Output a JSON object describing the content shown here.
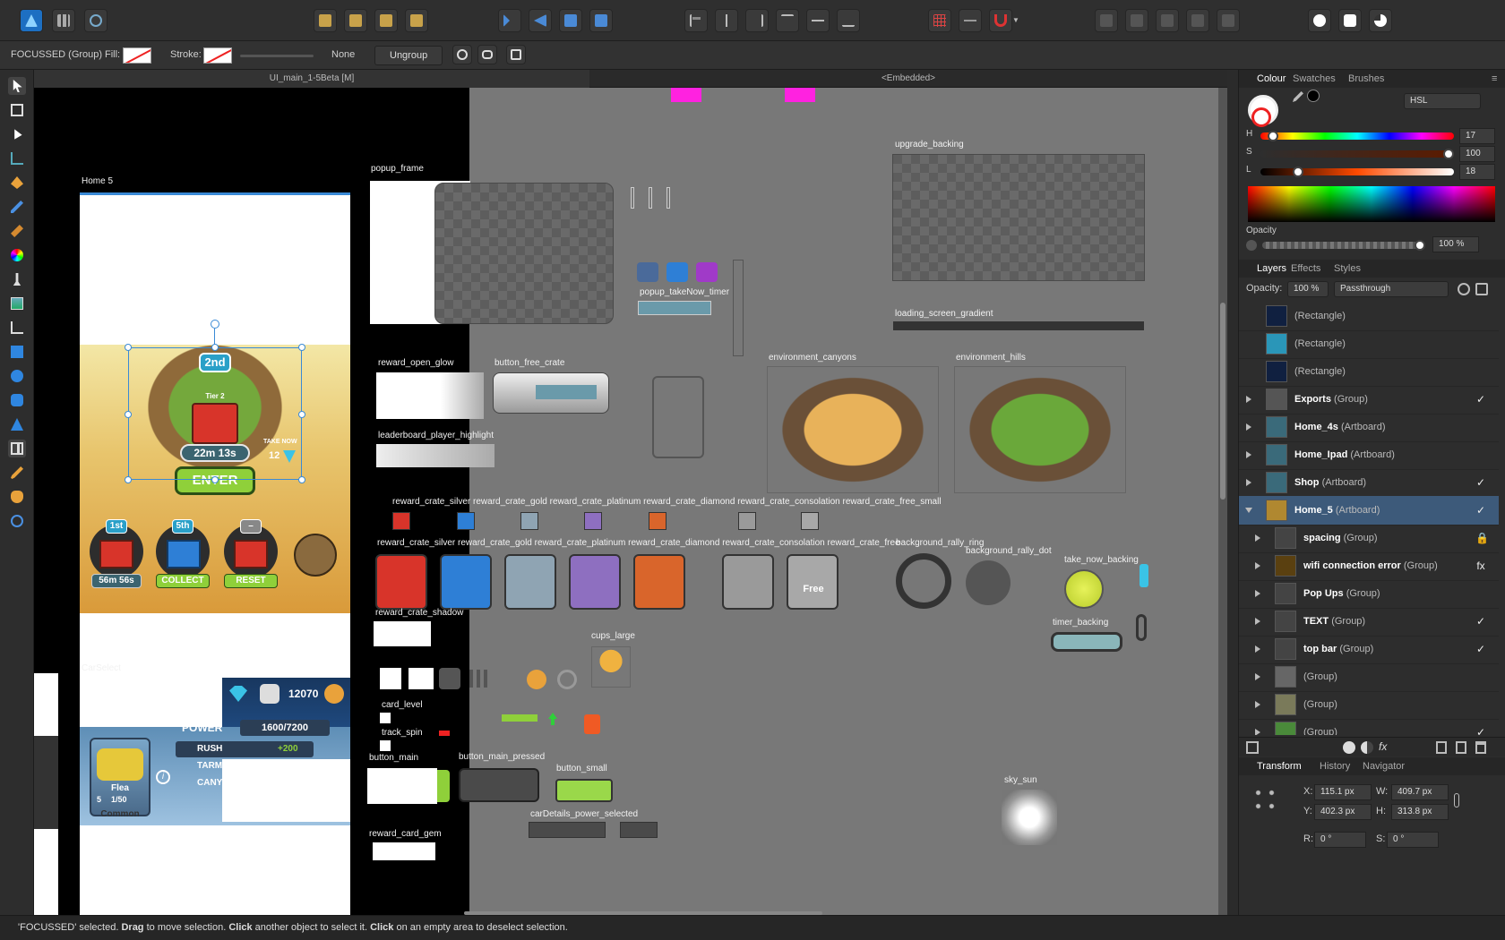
{
  "context_bar": {
    "selection": "FOCUSSED (Group)",
    "fill_label": "Fill:",
    "stroke_label": "Stroke:",
    "stroke_value": "None",
    "ungroup_label": "Ungroup"
  },
  "doc_tabs": [
    "UI_main_1-5Beta [M]",
    "<Embedded>"
  ],
  "canvas": {
    "labels": {
      "home5": "Home 5",
      "popup_frame": "popup_frame",
      "upgrade_backing": "upgrade_backing",
      "loading_gradient": "loading_screen_gradient",
      "reward_open_glow": "reward_open_glow",
      "button_free_crate": "button_free_crate",
      "leaderboard": "leaderboard_player_highlight",
      "popup_takenow": "popup_takeNow_timer",
      "env_canyons": "environment_canyons",
      "env_hills": "environment_hills",
      "reward_crate_small": "reward_crate_silver   reward_crate_gold   reward_crate_platinum   reward_crate_diamond   reward_crate_consolation   reward_crate_free_small",
      "reward_crate_big": "reward_crate_silver   reward_crate_gold   reward_crate_platinum   reward_crate_diamond   reward_crate_consolation   reward_crate_free",
      "bg_rally_ring": "background_rally_ring",
      "bg_rally_dot": "background_rally_dot",
      "take_now_backing": "take_now_backing",
      "timer_backing": "timer_backing",
      "reward_crate_shadow": "reward_crate_shadow",
      "cups_large": "cups_large",
      "card_level": "card_level",
      "track_spin": "track_spin",
      "button_main": "button_main",
      "button_main_pressed": "button_main_pressed",
      "button_small": "button_small",
      "sky_sun": "sky_sun",
      "carselect": "CarSelect",
      "reward_card_gem": "reward_card_gem",
      "cardetails": "carDetails_power_selected"
    },
    "home": {
      "tier_badge": "2nd",
      "tier_label": "Tier 2",
      "timer": "22m 13s",
      "take_now": "TAKE NOW",
      "take_now_count": "12",
      "enter_label": "ENTER",
      "slots": [
        {
          "badge": "1st",
          "label": "56m 56s",
          "color": "#d8342a"
        },
        {
          "badge": "5th",
          "label": "COLLECT",
          "color": "#2e7fd6"
        },
        {
          "badge": "–",
          "label": "RESET",
          "color": "#d8342a"
        }
      ]
    },
    "carselect": {
      "gems": "12070",
      "power_label": "POWER",
      "power_value": "1600/7200",
      "stats": [
        {
          "name": "RUSH",
          "value": "+200"
        },
        {
          "name": "TARM",
          "value": ""
        },
        {
          "name": "CANY",
          "value": ""
        }
      ],
      "car_name": "Flea",
      "car_level": "5",
      "car_progress": "1/50",
      "rarity": "Common"
    },
    "crate_colors": [
      "#d8342a",
      "#2e7fd6",
      "#8fa4b3",
      "#8e6fc0",
      "#d9652b",
      "#9a9a9a",
      "#a8a8a8"
    ],
    "free_label": "Free"
  },
  "colour_panel": {
    "tabs": [
      "Colour",
      "Swatches",
      "Brushes"
    ],
    "model": "HSL",
    "h": "17",
    "s": "100",
    "l": "18",
    "opacity_label": "Opacity",
    "opacity_value": "100 %"
  },
  "layers_panel": {
    "tabs": [
      "Layers",
      "Effects",
      "Styles"
    ],
    "opacity_label": "Opacity:",
    "opacity_value": "100 %",
    "blend_mode": "Passthrough",
    "rows": [
      {
        "name": "",
        "type": "(Rectangle)",
        "thumb": "#102040",
        "expand": false,
        "check": ""
      },
      {
        "name": "",
        "type": "(Rectangle)",
        "thumb": "#2a96b8",
        "expand": false,
        "check": ""
      },
      {
        "name": "",
        "type": "(Rectangle)",
        "thumb": "#102040",
        "expand": false,
        "check": ""
      },
      {
        "name": "Exports",
        "type": "(Group)",
        "thumb": "#555",
        "expand": true,
        "check": "✓"
      },
      {
        "name": "Home_4s",
        "type": "(Artboard)",
        "thumb": "#3a6a7a",
        "expand": true,
        "check": ""
      },
      {
        "name": "Home_Ipad",
        "type": "(Artboard)",
        "thumb": "#3a6a7a",
        "expand": true,
        "check": ""
      },
      {
        "name": "Shop",
        "type": "(Artboard)",
        "thumb": "#3a6a7a",
        "expand": true,
        "check": "✓"
      },
      {
        "name": "Home_5",
        "type": "(Artboard)",
        "thumb": "#b08830",
        "expand": true,
        "check": "✓",
        "selected": true
      },
      {
        "name": "spacing",
        "type": "(Group)",
        "thumb": "#444",
        "expand": true,
        "check": "🔒"
      },
      {
        "name": "wifi connection error",
        "type": "(Group)",
        "thumb": "#5a4010",
        "expand": true,
        "check": "fx"
      },
      {
        "name": "Pop Ups",
        "type": "(Group)",
        "thumb": "#444",
        "expand": true,
        "check": ""
      },
      {
        "name": "TEXT",
        "type": "(Group)",
        "thumb": "#444",
        "expand": true,
        "check": "✓"
      },
      {
        "name": "top bar",
        "type": "(Group)",
        "thumb": "#444",
        "expand": true,
        "check": "✓"
      },
      {
        "name": "",
        "type": "(Group)",
        "thumb": "#666",
        "expand": true,
        "check": ""
      },
      {
        "name": "",
        "type": "(Group)",
        "thumb": "#7a7a5a",
        "expand": true,
        "check": ""
      },
      {
        "name": "",
        "type": "(Group)",
        "thumb": "#4a8a3a",
        "expand": true,
        "check": "✓"
      }
    ]
  },
  "transform_panel": {
    "tabs": [
      "Transform",
      "History",
      "Navigator"
    ],
    "x": "115.1 px",
    "y": "402.3 px",
    "w": "409.7 px",
    "h": "313.8 px",
    "r": "0 °",
    "s": "0 °"
  },
  "status": {
    "selected": "'FOCUSSED' selected.",
    "drag": "Drag",
    "drag_text": "to move selection.",
    "click": "Click",
    "click_text": "another object to select it.",
    "click2": "Click",
    "click2_text": "on an empty area to deselect selection."
  }
}
